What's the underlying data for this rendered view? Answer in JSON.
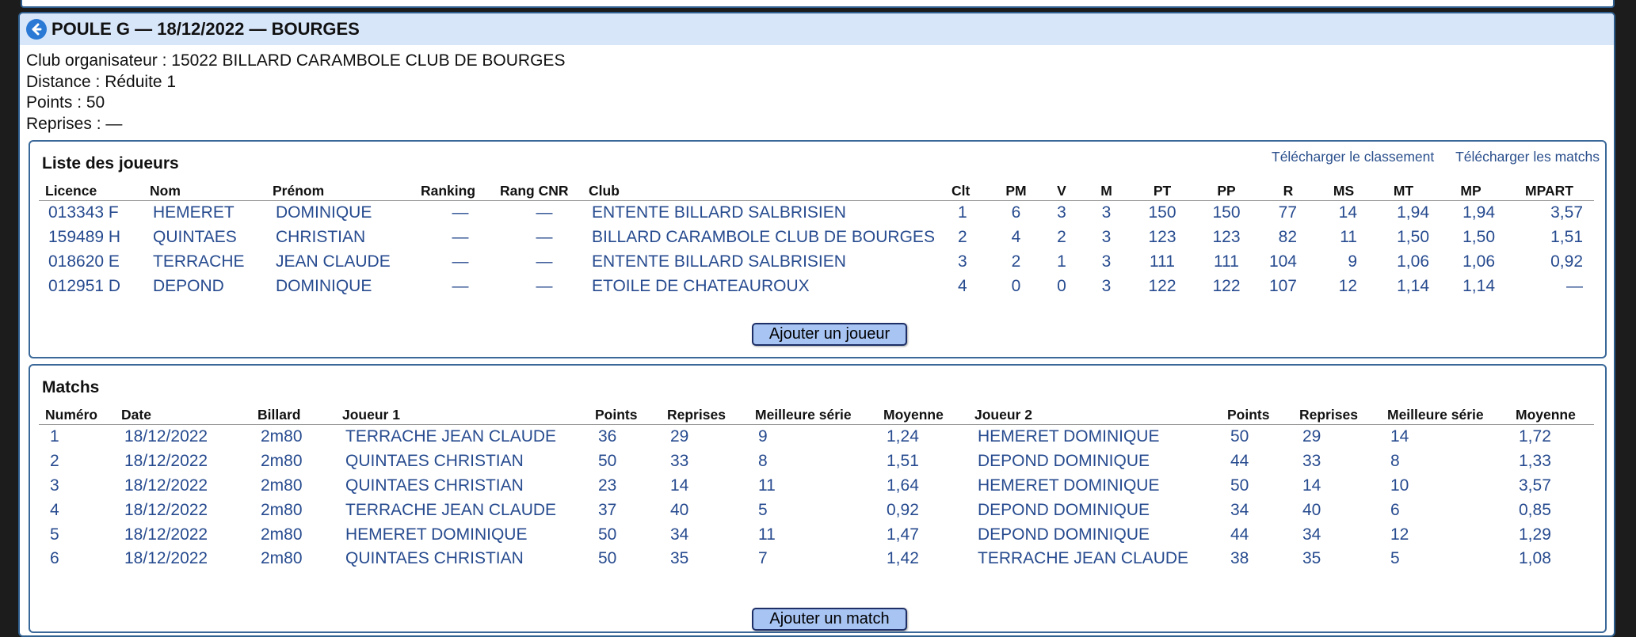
{
  "header": {
    "title": "POULE G — 18/12/2022 — BOURGES"
  },
  "info": {
    "club": "Club organisateur : 15022 BILLARD CARAMBOLE CLUB DE BOURGES",
    "distance": "Distance : Réduite 1",
    "points": "Points : 50",
    "reprises": "Reprises : —"
  },
  "players": {
    "title": "Liste des joueurs",
    "download_ranking": "Télécharger le classement",
    "download_matches": "Télécharger les matchs",
    "columns": [
      "Licence",
      "Nom",
      "Prénom",
      "Ranking",
      "Rang CNR",
      "Club",
      "Clt",
      "PM",
      "V",
      "M",
      "PT",
      "PP",
      "R",
      "MS",
      "MT",
      "MP",
      "MPART"
    ],
    "rows": [
      [
        "013343 F",
        "HEMERET",
        "DOMINIQUE",
        "—",
        "—",
        "ENTENTE BILLARD SALBRISIEN",
        "1",
        "6",
        "3",
        "3",
        "150",
        "150",
        "77",
        "14",
        "1,94",
        "1,94",
        "3,57"
      ],
      [
        "159489 H",
        "QUINTAES",
        "CHRISTIAN",
        "—",
        "—",
        "BILLARD CARAMBOLE CLUB DE BOURGES",
        "2",
        "4",
        "2",
        "3",
        "123",
        "123",
        "82",
        "11",
        "1,50",
        "1,50",
        "1,51"
      ],
      [
        "018620 E",
        "TERRACHE",
        "JEAN CLAUDE",
        "—",
        "—",
        "ENTENTE BILLARD SALBRISIEN",
        "3",
        "2",
        "1",
        "3",
        "111",
        "111",
        "104",
        "9",
        "1,06",
        "1,06",
        "0,92"
      ],
      [
        "012951 D",
        "DEPOND",
        "DOMINIQUE",
        "—",
        "—",
        "ETOILE DE CHATEAUROUX",
        "4",
        "0",
        "0",
        "3",
        "122",
        "122",
        "107",
        "12",
        "1,14",
        "1,14",
        "—"
      ]
    ],
    "add_button": "Ajouter un joueur"
  },
  "matches": {
    "title": "Matchs",
    "columns": [
      "Numéro",
      "Date",
      "Billard",
      "Joueur 1",
      "Points",
      "Reprises",
      "Meilleure série",
      "Moyenne",
      "Joueur 2",
      "Points",
      "Reprises",
      "Meilleure série",
      "Moyenne"
    ],
    "rows": [
      [
        "1",
        "18/12/2022",
        "2m80",
        "TERRACHE JEAN CLAUDE",
        "36",
        "29",
        "9",
        "1,24",
        "HEMERET DOMINIQUE",
        "50",
        "29",
        "14",
        "1,72"
      ],
      [
        "2",
        "18/12/2022",
        "2m80",
        "QUINTAES CHRISTIAN",
        "50",
        "33",
        "8",
        "1,51",
        "DEPOND DOMINIQUE",
        "44",
        "33",
        "8",
        "1,33"
      ],
      [
        "3",
        "18/12/2022",
        "2m80",
        "QUINTAES CHRISTIAN",
        "23",
        "14",
        "11",
        "1,64",
        "HEMERET DOMINIQUE",
        "50",
        "14",
        "10",
        "3,57"
      ],
      [
        "4",
        "18/12/2022",
        "2m80",
        "TERRACHE JEAN CLAUDE",
        "37",
        "40",
        "5",
        "0,92",
        "DEPOND DOMINIQUE",
        "34",
        "40",
        "6",
        "0,85"
      ],
      [
        "5",
        "18/12/2022",
        "2m80",
        "HEMERET DOMINIQUE",
        "50",
        "34",
        "11",
        "1,47",
        "DEPOND DOMINIQUE",
        "44",
        "34",
        "12",
        "1,29"
      ],
      [
        "6",
        "18/12/2022",
        "2m80",
        "QUINTAES CHRISTIAN",
        "50",
        "35",
        "7",
        "1,42",
        "TERRACHE JEAN CLAUDE",
        "38",
        "35",
        "5",
        "1,08"
      ]
    ],
    "add_button": "Ajouter un match"
  }
}
